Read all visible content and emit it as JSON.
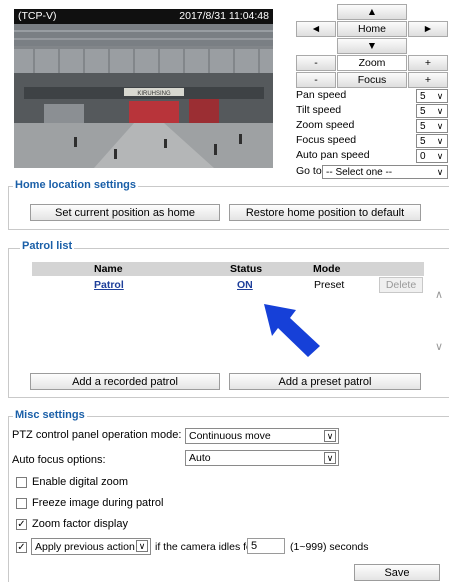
{
  "camera": {
    "source_label": "(TCP-V)",
    "timestamp": "2017/8/31 11:04:48",
    "sign_text": "KIRUHSING"
  },
  "ptz": {
    "up": "▲",
    "down": "▼",
    "left": "◄",
    "right": "►",
    "home": "Home",
    "zoom_label": "Zoom",
    "focus_label": "Focus",
    "minus": "-",
    "plus": "+",
    "speeds": [
      {
        "label": "Pan speed",
        "value": "5"
      },
      {
        "label": "Tilt speed",
        "value": "5"
      },
      {
        "label": "Zoom speed",
        "value": "5"
      },
      {
        "label": "Focus speed",
        "value": "5"
      },
      {
        "label": "Auto pan speed",
        "value": "0"
      }
    ],
    "goto_label": "Go to:",
    "goto_value": "-- Select one --"
  },
  "home_location": {
    "title": "Home location settings",
    "set_button": "Set current position as home",
    "restore_button": "Restore home position to default"
  },
  "patrol": {
    "title": "Patrol list",
    "columns": [
      "Name",
      "Status",
      "Mode"
    ],
    "rows": [
      {
        "name": "Patrol",
        "status": "ON",
        "mode": "Preset",
        "action": "Delete"
      }
    ],
    "add_recorded": "Add a recorded patrol",
    "add_preset": "Add a preset patrol"
  },
  "misc": {
    "title": "Misc settings",
    "operation_mode_label": "PTZ control panel operation mode:",
    "operation_mode_value": "Continuous move",
    "auto_focus_label": "Auto focus options:",
    "auto_focus_value": "Auto",
    "checkboxes": [
      {
        "label": "Enable digital zoom",
        "checked": false
      },
      {
        "label": "Freeze image during patrol",
        "checked": false
      },
      {
        "label": "Zoom factor display",
        "checked": true
      }
    ],
    "idle_checked": true,
    "idle_action": "Apply previous action",
    "idle_text": "if the camera idles for",
    "idle_value": "5",
    "idle_range": "(1~999) seconds",
    "save_button": "Save"
  },
  "colors": {
    "legend": "#1a5fa8",
    "arrow": "#1640d8",
    "link": "#1e3f9a"
  }
}
